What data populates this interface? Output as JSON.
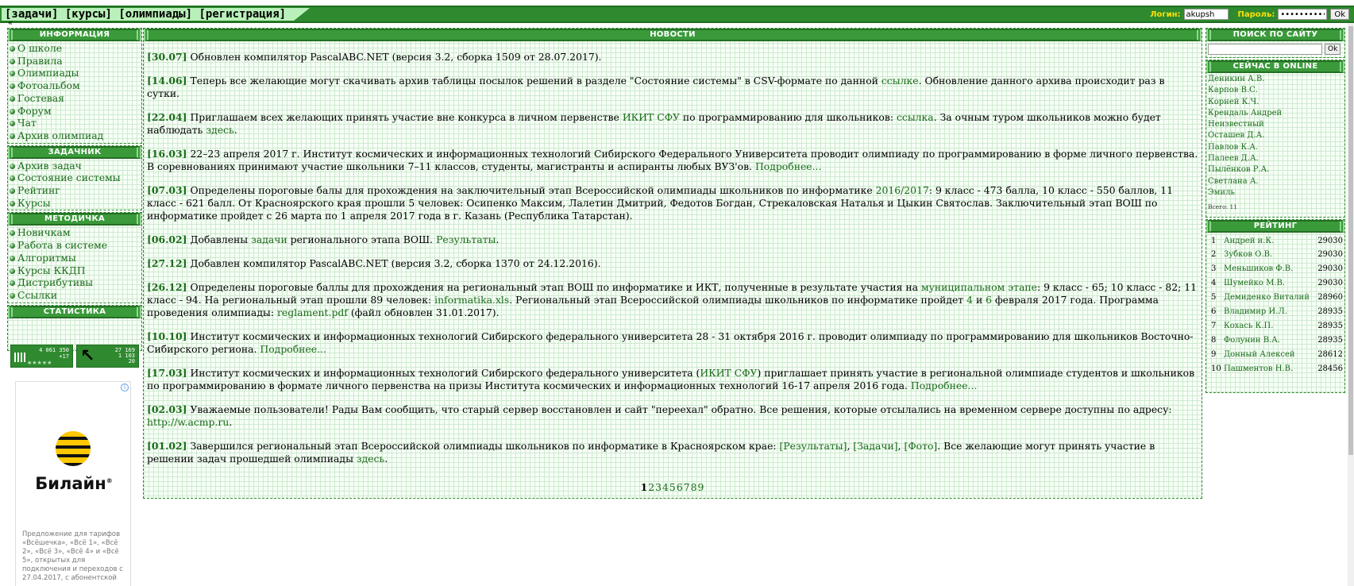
{
  "header": {
    "logo_text": "",
    "nav": [
      {
        "label": "[задачи]"
      },
      {
        "label": "[курсы]"
      },
      {
        "label": "[олимпиады]"
      },
      {
        "label": "[регистрация]"
      }
    ],
    "login_label": "Логин:",
    "login_value": "akupsh",
    "password_label": "Пароль:",
    "password_value": "••••••••••",
    "ok_label": "Ok",
    "collapse_glyph": "«"
  },
  "left": {
    "info": {
      "title": "ИНФОРМАЦИЯ",
      "items": [
        "О школе",
        "Правила",
        "Олимпиады",
        "Фотоальбом",
        "Гостевая",
        "Форум",
        "Чат",
        "Архив олимпиад"
      ]
    },
    "tasks": {
      "title": "ЗАДАЧНИК",
      "items": [
        "Архив задач",
        "Состояние системы",
        "Рейтинг",
        "Курсы"
      ]
    },
    "method": {
      "title": "МЕТОДИЧКА",
      "items": [
        "Новичкам",
        "Работа в системе",
        "Алгоритмы",
        "Курсы ККДП",
        "Дистрибутивы",
        "Ссылки"
      ]
    },
    "stats": {
      "title": "СТАТИСТИКА",
      "counter1": {
        "line1": "4 061 350",
        "line2": "+17",
        "label": "hotlog",
        "stars": "★★★★★"
      },
      "counter2": {
        "arrow": "↖",
        "line1": "27 169",
        "line2": "1 103",
        "line3": "20"
      }
    },
    "ad": {
      "info_icon": "i",
      "brand": "Билайн",
      "brand_mark": "®",
      "text": "Предложение для тарифов «Всёшечка», «Всё 1», «Всё 2», «Всё 3», «Всё 4» и «Всё 5», открытых для подключения и переходов с 27.04.2017, с абонентской"
    }
  },
  "main": {
    "title": "НОВОСТИ",
    "news": [
      {
        "date": "[30.07]",
        "parts": [
          {
            "t": " Обновлен компилятор PascalABC.NET (версия 3.2, сборка 1509 от 28.07.2017)."
          }
        ]
      },
      {
        "date": "[14.06]",
        "parts": [
          {
            "t": " Теперь все желающие могут скачивать архив таблицы посылок решений в разделе \"Состояние системы\" в CSV-формате по данной "
          },
          {
            "t": "ссылке",
            "link": true
          },
          {
            "t": ". Обновление данного архива происходит раз в сутки."
          }
        ]
      },
      {
        "date": "[22.04]",
        "parts": [
          {
            "t": " Приглашаем всех желающих принять участие вне конкурса в личном первенстве "
          },
          {
            "t": "ИКИТ СФУ",
            "link": true
          },
          {
            "t": " по программированию для школьников: "
          },
          {
            "t": "ссылка",
            "link": true
          },
          {
            "t": ". За очным туром школьников можно будет наблюдать "
          },
          {
            "t": "здесь",
            "link": true
          },
          {
            "t": "."
          }
        ]
      },
      {
        "date": "[16.03]",
        "parts": [
          {
            "t": " 22–23 апреля 2017 г. Институт космических и информационных технологий Сибирского Федерального Университета проводит олимпиаду по программированию в форме личного первенства. В соревнованиях принимают участие школьники 7–11 классов, студенты, магистранты и аспиранты любых ВУЗ'ов. "
          },
          {
            "t": "Подробнее...",
            "link": true
          }
        ]
      },
      {
        "date": "[07.03]",
        "parts": [
          {
            "t": " Определены пороговые балы для прохождения на заключительный этап Всероссийской олимпиады школьников по информатике "
          },
          {
            "t": "2016/2017",
            "link": true
          },
          {
            "t": ": 9 класс - 473 балла, 10 класс - 550 баллов, 11 класс - 621 балл. От Красноярского края прошли 5 человек: Осипенко Максим, Лалетин Дмитрий, Федотов Богдан, Стрекаловская Наталья и Цыкин Святослав. Заключительный этап ВОШ по информатике пройдет с 26 марта по 1 апреля 2017 года в г. Казань (Республика Татарстан)."
          }
        ]
      },
      {
        "date": "[06.02]",
        "parts": [
          {
            "t": " Добавлены "
          },
          {
            "t": "задачи",
            "link": true
          },
          {
            "t": " регионального этапа ВОШ. "
          },
          {
            "t": "Результаты",
            "link": true
          },
          {
            "t": "."
          }
        ]
      },
      {
        "date": "[27.12]",
        "parts": [
          {
            "t": " Добавлен компилятор PascalABC.NET (версия 3.2, сборка 1370 от 24.12.2016)."
          }
        ]
      },
      {
        "date": "[26.12]",
        "parts": [
          {
            "t": " Определены пороговые баллы для прохождения на региональный этап ВОШ по информатике и ИКТ, полученные в результате участия на "
          },
          {
            "t": "муниципальном этапе",
            "link": true
          },
          {
            "t": ": 9 класс - 65; 10 класс - 82; 11 класс - 94. На региональный этап прошли 89 человек: "
          },
          {
            "t": "informatika.xls",
            "link": true
          },
          {
            "t": ". Региональный этап Всероссийской олимпиады школьников по информатике пройдет "
          },
          {
            "t": "4",
            "link": true
          },
          {
            "t": " и "
          },
          {
            "t": "6",
            "link": true
          },
          {
            "t": " февраля 2017 года. Программа проведения олимпиады: "
          },
          {
            "t": "reglament.pdf",
            "link": true
          },
          {
            "t": " (файл обновлен 31.01.2017)."
          }
        ]
      },
      {
        "date": "[10.10]",
        "parts": [
          {
            "t": " Институт космических и информационных технологий Сибирского федерального университета 28 - 31 октября 2016 г. проводит олимпиаду по программированию для школьников Восточно-Сибирского региона. "
          },
          {
            "t": "Подробнее...",
            "link": true
          }
        ]
      },
      {
        "date": "[17.03]",
        "parts": [
          {
            "t": " Институт космических и информационных технологий Сибирского федерального университета ("
          },
          {
            "t": "ИКИТ СФУ",
            "link": true
          },
          {
            "t": ") приглашает принять участие в региональной олимпиаде студентов и школьников по программированию в формате личного первенства на призы Института космических и информационных технологий 16-17 апреля 2016 года. "
          },
          {
            "t": "Подробнее...",
            "link": true
          }
        ]
      },
      {
        "date": "[02.03]",
        "parts": [
          {
            "t": " Уважаемые пользователи! Рады Вам сообщить, что старый сервер восстановлен и сайт \"переехал\" обратно. Все решения, которые отсылались на временном сервере доступны по адресу: "
          },
          {
            "t": "http://w.acmp.ru",
            "link": true
          },
          {
            "t": "."
          }
        ]
      },
      {
        "date": "[01.02]",
        "parts": [
          {
            "t": " Завершился региональный этап Всероссийской олимпиады школьников по информатике в Красноярском крае: "
          },
          {
            "t": "[Результаты]",
            "link": true
          },
          {
            "t": ", "
          },
          {
            "t": "[Задачи]",
            "link": true
          },
          {
            "t": ", "
          },
          {
            "t": "[Фото]",
            "link": true
          },
          {
            "t": ". Все желающие могут принять участие в решении задач прошедшей олимпиады "
          },
          {
            "t": "здесь",
            "link": true
          },
          {
            "t": "."
          }
        ]
      }
    ],
    "pages": [
      "1",
      "2",
      "3",
      "4",
      "5",
      "6",
      "7",
      "8",
      "9"
    ],
    "current_page": "1"
  },
  "right": {
    "search": {
      "title": "ПОИСК ПО САЙТУ",
      "ok_label": "Ok",
      "value": ""
    },
    "online": {
      "title": "СЕЙЧАС В ONLINE",
      "users": [
        "Деникин А.В.",
        "Карпов В.С.",
        "Корней К.Ч.",
        "Крендаль Андрей",
        "Неизвестный",
        "Осташев Д.А.",
        "Павлов К.А.",
        "Палеев Д.А.",
        "Пылёнков Р.А.",
        "Светлана А.",
        "Эмиль"
      ],
      "total": "Всего: 11"
    },
    "rating": {
      "title": "РЕЙТИНГ",
      "rows": [
        {
          "n": "1",
          "name": "Андрей и.К.",
          "score": "29030"
        },
        {
          "n": "2",
          "name": "Зубков О.В.",
          "score": "29030"
        },
        {
          "n": "3",
          "name": "Меньшиков Ф.В.",
          "score": "29030"
        },
        {
          "n": "4",
          "name": "Шумейко М.В.",
          "score": "29030"
        },
        {
          "n": "5",
          "name": "Демиденко Виталий",
          "score": "28960"
        },
        {
          "n": "6",
          "name": "Владимир И.Л.",
          "score": "28935"
        },
        {
          "n": "7",
          "name": "Кохась К.П.",
          "score": "28935"
        },
        {
          "n": "8",
          "name": "Фолунин В.А.",
          "score": "28935"
        },
        {
          "n": "9",
          "name": "Донный Алексей",
          "score": "28612"
        },
        {
          "n": "10",
          "name": "Пашментов Н.В.",
          "score": "28456"
        }
      ]
    }
  }
}
